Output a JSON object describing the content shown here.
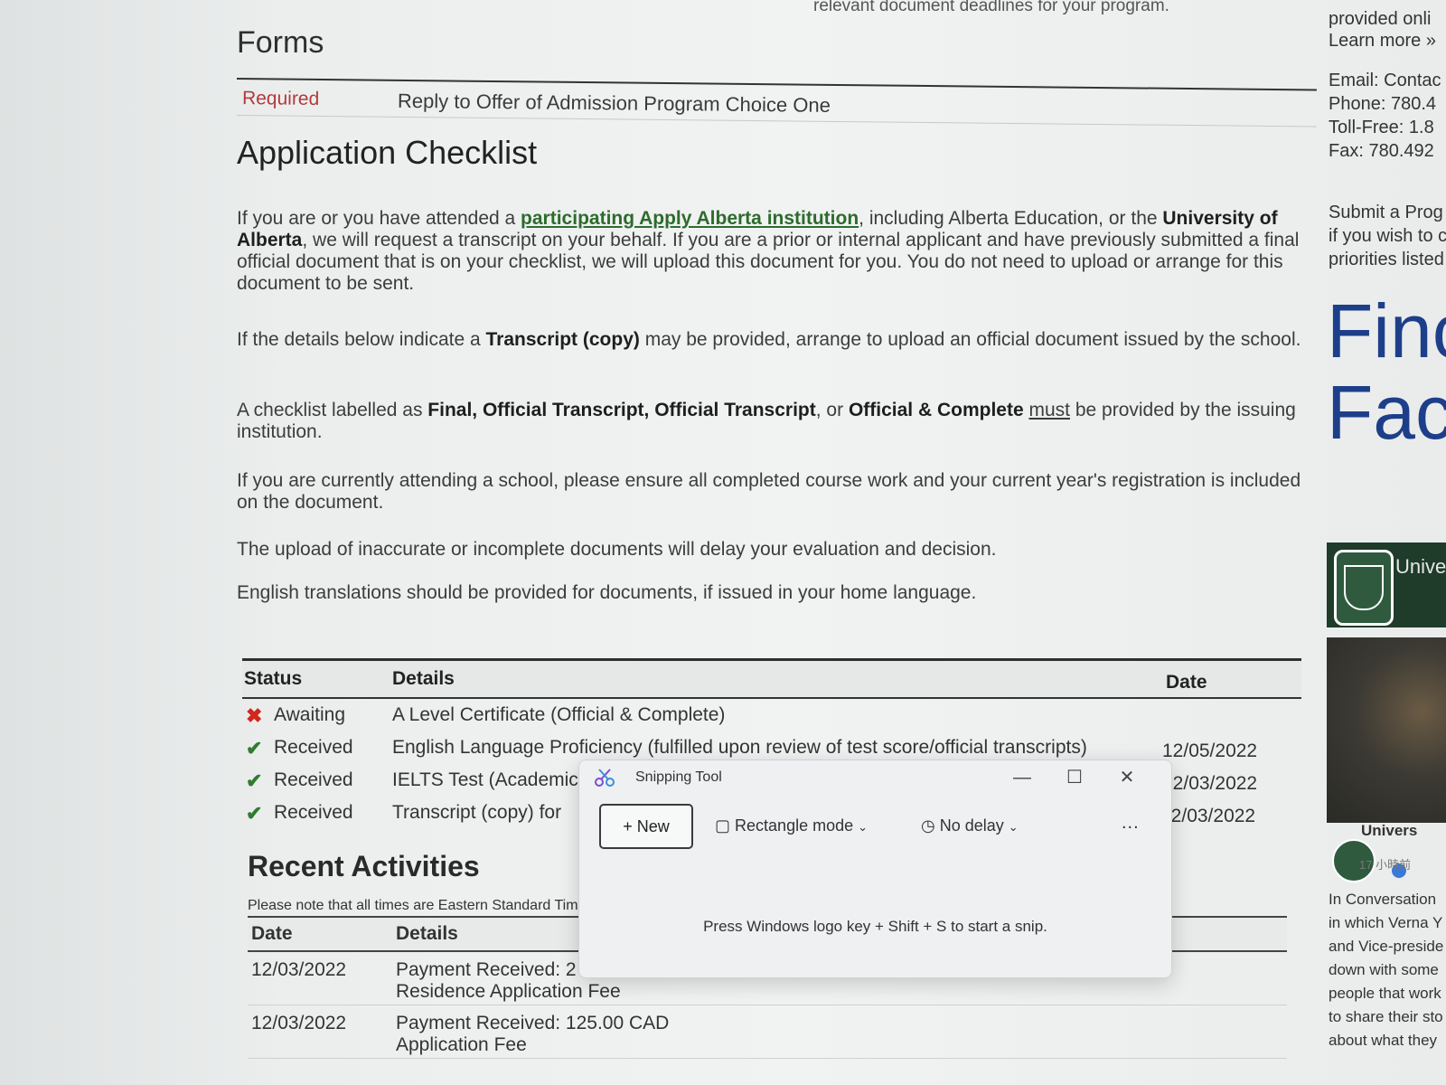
{
  "top_fragment": "relevant document deadlines for your program.",
  "forms": {
    "title": "Forms",
    "status": "Required",
    "link": "Reply to Offer of Admission Program Choice One"
  },
  "checklist": {
    "title": "Application Checklist",
    "p1_a": "If you are or you have attended a ",
    "p1_link": "participating Apply Alberta institution",
    "p1_b": ", including Alberta Education, or the ",
    "p1_bold": "University of Alberta",
    "p1_c": ", we will request a transcript on your behalf. If you are a prior or internal applicant and have previously submitted a final official document that is on your checklist, we will upload this document for you. You do not need to upload or arrange for this document to be sent.",
    "p2_a": "If the details below indicate a ",
    "p2_bold": "Transcript (copy)",
    "p2_b": " may be provided, arrange to upload an official document issued by the school.",
    "p3_a": "A checklist labelled as ",
    "p3_bold1": "Final, Official Transcript, Official Transcript",
    "p3_b": ", or ",
    "p3_bold2": "Official & Complete",
    "p3_c": " ",
    "p3_u": "must",
    "p3_d": " be provided by the issuing institution.",
    "p4": "If you are currently attending a school, please ensure all completed course work and your current year's registration is included on the document.",
    "p5": "The upload of inaccurate or incomplete documents will delay your evaluation and decision.",
    "p6": "English translations should be provided for documents, if issued in your home language."
  },
  "checklist_table": {
    "headers": {
      "status": "Status",
      "details": "Details",
      "date": "Date"
    },
    "rows": [
      {
        "icon": "x-icon",
        "status": "Awaiting",
        "details": "A Level Certificate (Official & Complete)",
        "date": ""
      },
      {
        "icon": "check-icon",
        "status": "Received",
        "details": "English Language Proficiency (fulfilled upon review of test score/official transcripts)",
        "date": "12/05/2022"
      },
      {
        "icon": "check-icon",
        "status": "Received",
        "details": "IELTS Test (Academic",
        "date": "12/03/2022"
      },
      {
        "icon": "check-icon",
        "status": "Received",
        "details": "Transcript (copy) for",
        "date": "12/03/2022"
      }
    ]
  },
  "recent": {
    "title": "Recent Activities",
    "note": "Please note that all times are Eastern Standard Time",
    "headers": {
      "date": "Date",
      "details": "Details"
    },
    "rows": [
      {
        "date": "12/03/2022",
        "line1": "Payment Received: 2",
        "line2": "Residence Application Fee"
      },
      {
        "date": "12/03/2022",
        "line1": "Payment Received: 125.00 CAD",
        "line2": "Application Fee"
      }
    ]
  },
  "sidebar": {
    "l1": "provided onli",
    "l2": "Learn more »",
    "email": "Email: Contac",
    "phone": "Phone: 780.4",
    "tollfree": "Toll-Free: 1.8",
    "fax": "Fax: 780.492",
    "s1": "Submit a Prog",
    "s2": "if you wish to c",
    "s3": "priorities listed",
    "big1": "Finc",
    "big2": "Fac",
    "ua_label": "Unive",
    "post_name": "Univers",
    "post_time": "17 小時前",
    "post1": "In Conversation",
    "post2": "in which Verna Y",
    "post3": "and Vice-preside",
    "post4": "down with some",
    "post5": "people that work",
    "post6": "to share their sto",
    "post7": "about what they"
  },
  "snipping_tool": {
    "title": "Snipping Tool",
    "new_label": "New",
    "mode_label": "Rectangle mode",
    "delay_label": "No delay",
    "more_label": "...",
    "hint": "Press Windows logo key + Shift + S to start a snip.",
    "minimize": "—",
    "maximize": "☐",
    "close": "✕"
  },
  "colors": {
    "link_green": "#2d6b2d",
    "awaiting_red": "#d0281c",
    "received_green": "#2e7d2e",
    "required_red": "#b13a3a",
    "ua_green": "#1f3b2a",
    "heading_blue": "#1d3f8a"
  }
}
